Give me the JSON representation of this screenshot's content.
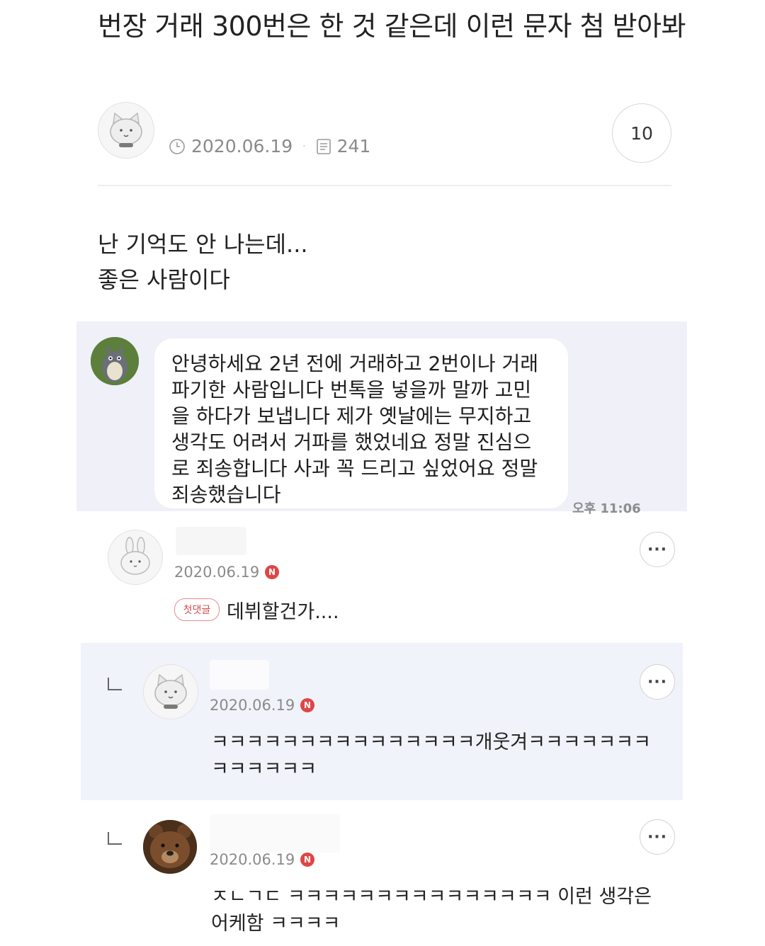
{
  "post": {
    "title": "번장 거래 300번은 한 것 같은데 이런 문자 첨 받아봐",
    "date": "2020.06.19",
    "views": "241",
    "comment_count": "10",
    "body_lines": [
      "난 기억도 안 나는데...",
      "좋은 사람이다"
    ]
  },
  "sms": {
    "lines": [
      "안녕하세요 2년 전에 거래하고 2번이나 거래",
      "파기한 사람입니다 번톡을 넣을까 말까 고민",
      "을 하다가 보냅니다 제가 옛날에는 무지하고",
      "생각도 어려서 거파를 했었네요 정말 진심으",
      "로 죄송합니다 사과 꼭 드리고 싶었어요 정말",
      "죄송했습니다"
    ],
    "time": "오후 11:06"
  },
  "comments": [
    {
      "date": "2020.06.19",
      "badge": "N",
      "tag": "첫댓글",
      "text": "데뷔할건가...."
    },
    {
      "date": "2020.06.19",
      "badge": "N",
      "lines": [
        "ㅋㅋㅋㅋㅋㅋㅋㅋㅋㅋㅋㅋㅋㅋㅋ개웃겨ㅋㅋㅋㅋㅋㅋㅋ",
        "ㅋㅋㅋㅋㅋㅋ"
      ]
    },
    {
      "date": "2020.06.19",
      "badge": "N",
      "lines": [
        "ㅈㄴㄱㄷ ㅋㅋㅋㅋㅋㅋㅋㅋㅋㅋㅋㅋㅋㅋㅋ 이런 생각은",
        "어케함 ㅋㅋㅋㅋ"
      ]
    }
  ],
  "more_label": "···",
  "icons": {
    "clock": "clock-icon",
    "views": "document-icon",
    "more": "more-icon",
    "reply": "reply-arrow-icon"
  }
}
